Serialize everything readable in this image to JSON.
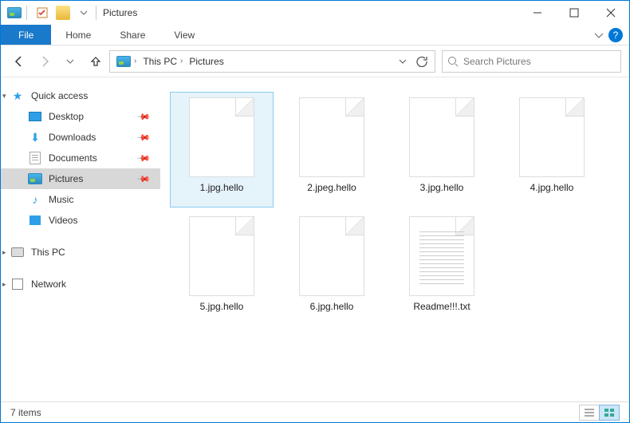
{
  "window": {
    "title": "Pictures"
  },
  "ribbon": {
    "file_label": "File",
    "tabs": [
      "Home",
      "Share",
      "View"
    ]
  },
  "nav": {
    "breadcrumb": [
      "This PC",
      "Pictures"
    ],
    "search_placeholder": "Search Pictures"
  },
  "sidebar": {
    "quick_access": {
      "label": "Quick access",
      "items": [
        {
          "label": "Desktop",
          "pinned": true,
          "icon": "desktop"
        },
        {
          "label": "Downloads",
          "pinned": true,
          "icon": "downloads"
        },
        {
          "label": "Documents",
          "pinned": true,
          "icon": "documents"
        },
        {
          "label": "Pictures",
          "pinned": true,
          "icon": "pictures",
          "selected": true
        },
        {
          "label": "Music",
          "pinned": false,
          "icon": "music"
        },
        {
          "label": "Videos",
          "pinned": false,
          "icon": "videos"
        }
      ]
    },
    "this_pc": {
      "label": "This PC"
    },
    "network": {
      "label": "Network"
    }
  },
  "files": [
    {
      "name": "1.jpg.hello",
      "type": "blank",
      "selected": true
    },
    {
      "name": "2.jpeg.hello",
      "type": "blank"
    },
    {
      "name": "3.jpg.hello",
      "type": "blank"
    },
    {
      "name": "4.jpg.hello",
      "type": "blank"
    },
    {
      "name": "5.jpg.hello",
      "type": "blank"
    },
    {
      "name": "6.jpg.hello",
      "type": "blank"
    },
    {
      "name": "Readme!!!.txt",
      "type": "text"
    }
  ],
  "status": {
    "item_count_label": "7 items"
  }
}
